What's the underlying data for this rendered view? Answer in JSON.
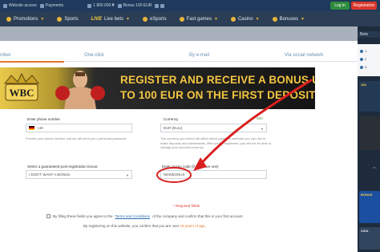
{
  "topbar": {
    "website_access": "Website access",
    "payments": "Payments",
    "phone": "1 800 000 ₴",
    "bonus": "Bonus 100 EUR",
    "login": "Log in",
    "registration": "Registration"
  },
  "nav": {
    "promotions": "Promotions",
    "sports": "Sports",
    "live_word": "LIVE",
    "live_bets": "Live bets",
    "esports": "eSports",
    "fast_games": "Fast games",
    "casino": "Casino",
    "bonuses": "Bonuses"
  },
  "tabs": {
    "number": "mber",
    "one_click": "One-click",
    "email": "By e-mail",
    "social": "Via social network"
  },
  "banner": {
    "logo": "WBC",
    "line1": "REGISTER AND RECEIVE A BONUS UP",
    "line2": "TO 100 EUR ON THE FIRST DEPOSIT!"
  },
  "form": {
    "phone_label": "Enter phone number",
    "phone_value": "+49",
    "phone_hint": "Provide your phone number and we will send you a personal password",
    "currency_label": "Currency",
    "currency_ok": "OK!",
    "currency_value": "EUR (Euro)",
    "currency_hint": "The currency you select will affect which payment methods you can use to make deposits and withdrawals. After you've registered, you will not be able to change your account currency.",
    "bonus_label": "Select a guaranteed post-registration bonus:",
    "bonus_value": "I DON'T WANT A BONUS",
    "promo_label": "Enter promo code (if you have one)",
    "promo_value": "NEWBONUS",
    "required": "* Required fields",
    "terms_prefix": "By filling these fields you agree to the",
    "terms_link": "Terms and Conditions",
    "terms_suffix": "of the company and confirm that this is your first account",
    "age_prefix": "By registering on this website, you confirm that you are over",
    "age_value": "18 years of age",
    "age_suffix": "."
  },
  "right_panel": {
    "heading": "Bets",
    "rows": [
      "1",
      "2",
      "3"
    ],
    "card1": "100",
    "card2": "BONUS",
    "card3": "ASIA"
  },
  "colors": {
    "accent": "#e8742a",
    "annotation": "#d9201e",
    "nav_bg": "#2b3e55",
    "gold": "#f4c542"
  }
}
